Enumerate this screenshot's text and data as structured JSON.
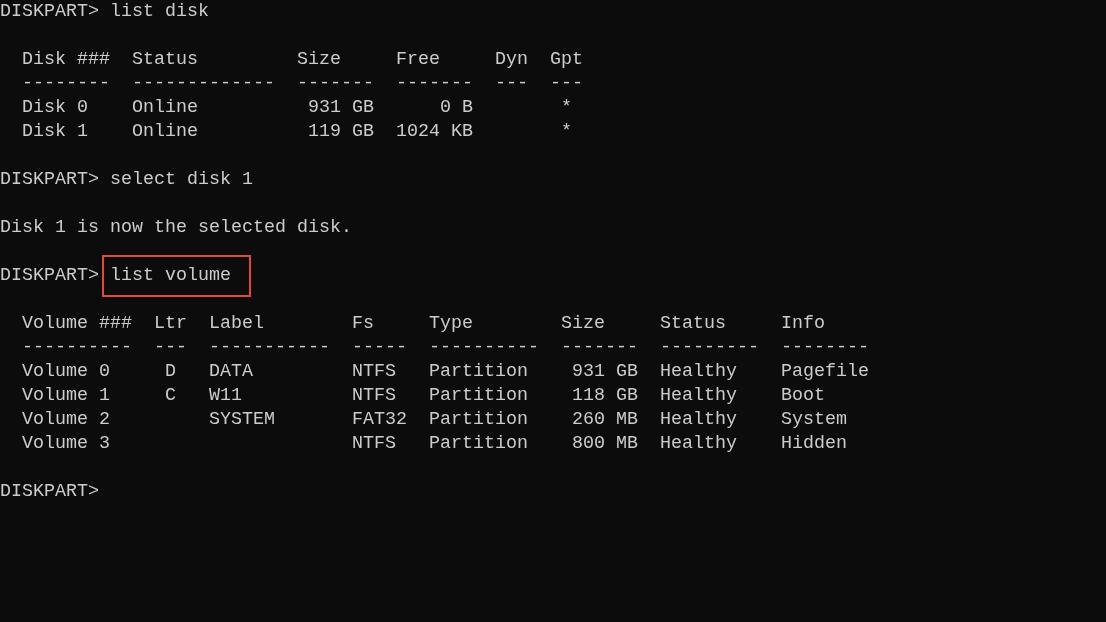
{
  "terminal": {
    "lines": [
      {
        "kind": "prompt",
        "prompt": "DISKPART>",
        "command": "list disk"
      },
      {
        "kind": "blank"
      },
      {
        "kind": "output",
        "text": "  Disk ###  Status         Size     Free     Dyn  Gpt"
      },
      {
        "kind": "output",
        "text": "  --------  -------------  -------  -------  ---  ---"
      },
      {
        "kind": "output",
        "text": "  Disk 0    Online          931 GB      0 B        *"
      },
      {
        "kind": "output",
        "text": "  Disk 1    Online          119 GB  1024 KB        *"
      },
      {
        "kind": "blank"
      },
      {
        "kind": "prompt",
        "prompt": "DISKPART>",
        "command": "select disk 1"
      },
      {
        "kind": "blank"
      },
      {
        "kind": "output",
        "text": "Disk 1 is now the selected disk."
      },
      {
        "kind": "blank"
      },
      {
        "kind": "prompt",
        "prompt": "DISKPART>",
        "command": "list volume",
        "highlighted": true
      },
      {
        "kind": "blank"
      },
      {
        "kind": "output",
        "text": "  Volume ###  Ltr  Label        Fs     Type        Size     Status     Info"
      },
      {
        "kind": "output",
        "text": "  ----------  ---  -----------  -----  ----------  -------  ---------  --------"
      },
      {
        "kind": "output",
        "text": "  Volume 0     D   DATA         NTFS   Partition    931 GB  Healthy    Pagefile"
      },
      {
        "kind": "output",
        "text": "  Volume 1     C   W11          NTFS   Partition    118 GB  Healthy    Boot"
      },
      {
        "kind": "output",
        "text": "  Volume 2         SYSTEM       FAT32  Partition    260 MB  Healthy    System"
      },
      {
        "kind": "output",
        "text": "  Volume 3                      NTFS   Partition    800 MB  Healthy    Hidden"
      },
      {
        "kind": "blank"
      },
      {
        "kind": "prompt",
        "prompt": "DISKPART>"
      }
    ]
  }
}
